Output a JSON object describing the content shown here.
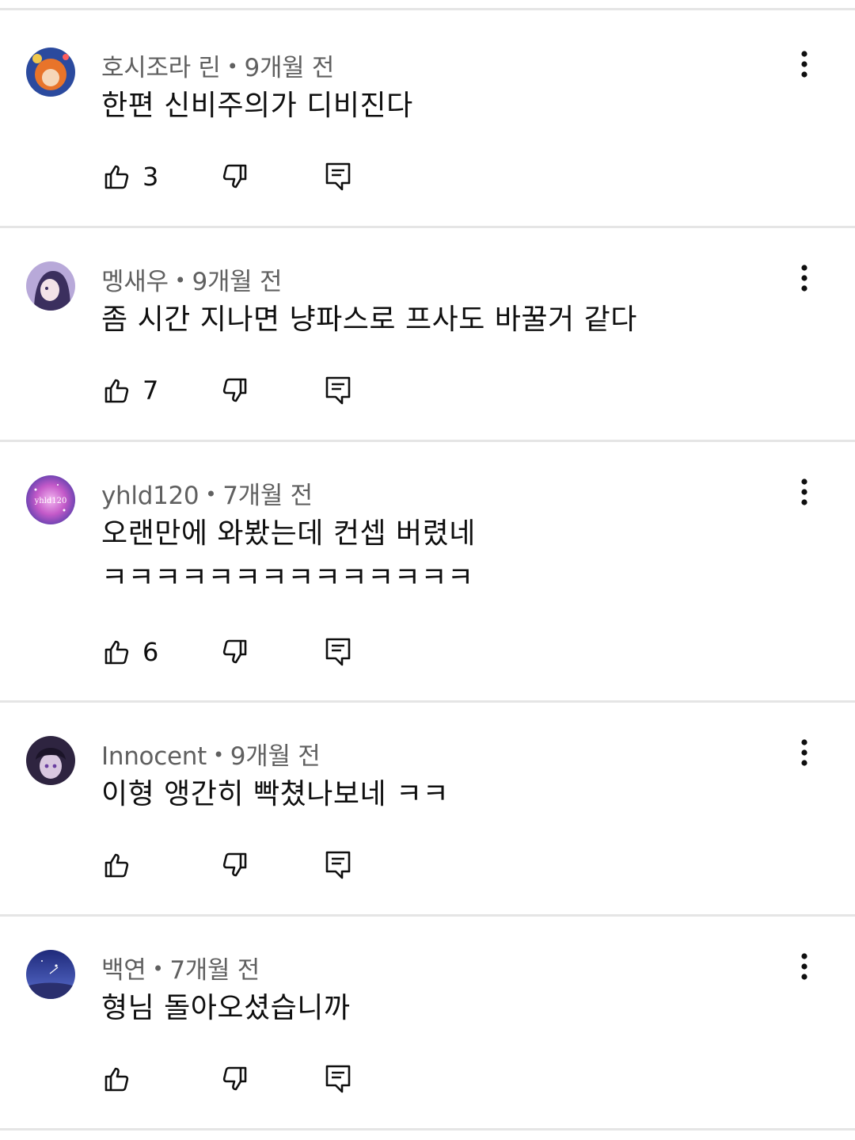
{
  "comments": [
    {
      "author": "호시조라 린",
      "separator": "•",
      "time": "9개월 전",
      "text_lines": [
        "한편 신비주의가 디비진다"
      ],
      "likes": "3",
      "avatar_icon": "anime-avatar-orange",
      "colors": {
        "a": "#e8742a",
        "b": "#2b4a9e"
      }
    },
    {
      "author": "멩새우",
      "separator": "•",
      "time": "9개월 전",
      "text_lines": [
        "좀 시간 지나면 냥파스로 프사도 바꿀거 같다"
      ],
      "likes": "7",
      "avatar_icon": "anime-avatar-purple",
      "colors": {
        "a": "#b8a9d9",
        "b": "#3b2f5e"
      }
    },
    {
      "author": "yhld120",
      "separator": "•",
      "time": "7개월 전",
      "text_lines": [
        "오랜만에 와봤는데 컨셉 버렸네",
        "ㅋㅋㅋㅋㅋㅋㅋㅋㅋㅋㅋㅋㅋㅋ"
      ],
      "likes": "6",
      "avatar_icon": "galaxy-avatar",
      "avatar_text": "yhld120",
      "colors": {
        "a": "#c45ac9",
        "b": "#4a3aa8"
      }
    },
    {
      "author": "Innocent",
      "separator": "•",
      "time": "9개월 전",
      "text_lines": [
        "이형 앵간히 빡쳤나보네 ㅋㅋ"
      ],
      "likes": "",
      "avatar_icon": "anime-avatar-dark",
      "colors": {
        "a": "#2e2440",
        "b": "#d9c8e0"
      }
    },
    {
      "author": "백연",
      "separator": "•",
      "time": "7개월 전",
      "text_lines": [
        "형님 돌아오셨습니까"
      ],
      "likes": "",
      "avatar_icon": "night-sky-avatar",
      "colors": {
        "a": "#1f2a7a",
        "b": "#5a6fd0"
      }
    }
  ],
  "icons": {
    "like": "thumbs-up-icon",
    "dislike": "thumbs-down-icon",
    "reply": "reply-icon",
    "more": "more-vert-icon"
  }
}
